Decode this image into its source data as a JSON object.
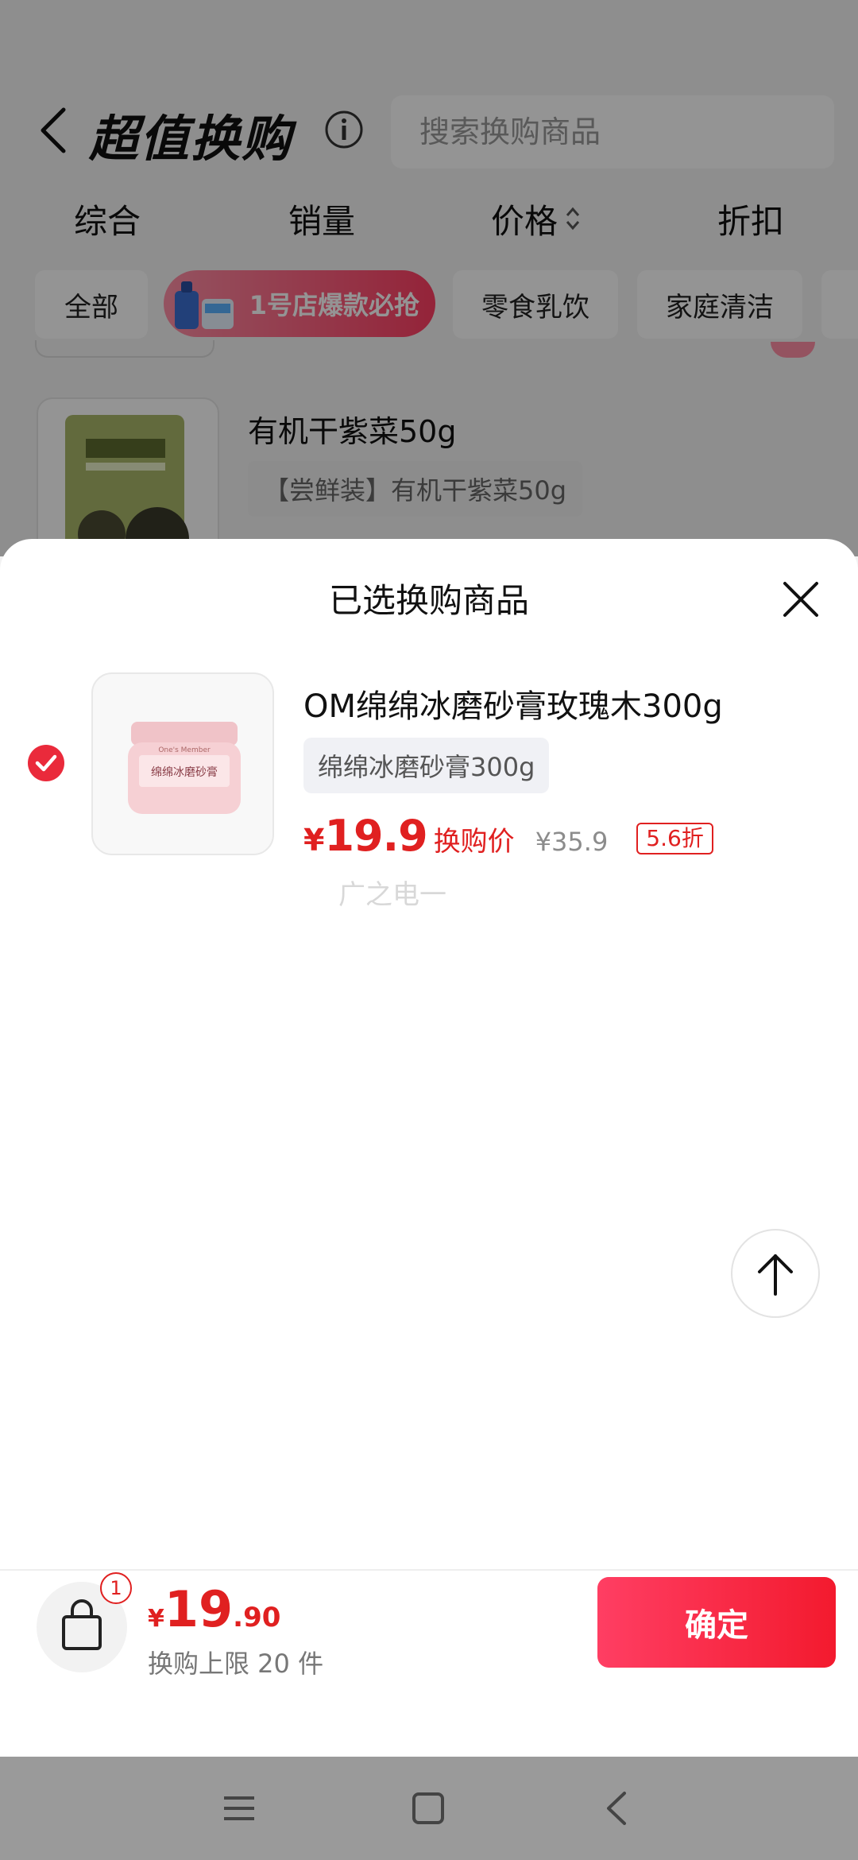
{
  "header": {
    "title": "超值换购",
    "search_placeholder": "搜索换购商品"
  },
  "sort_tabs": [
    "综合",
    "销量",
    "价格",
    "折扣"
  ],
  "categories": {
    "all": "全部",
    "promo": "1号店爆款必抢",
    "snacks": "零食乳饮",
    "cleaning": "家庭清洁"
  },
  "background_product": {
    "title": "有机干紫菜50g",
    "subtitle": "【尝鲜装】有机干紫菜50g"
  },
  "sheet": {
    "title": "已选换购商品",
    "item": {
      "title": "OM绵绵冰磨砂膏玫瑰木300g",
      "spec": "绵绵冰磨砂膏300g",
      "price_symbol": "¥",
      "price": "19.9",
      "price_tag": "换购价",
      "original_price": "¥35.9",
      "discount": "5.6折",
      "selected": true,
      "jar_label": "绵绵冰磨砂膏",
      "jar_brand": "One's Member"
    },
    "watermark": "广之电一"
  },
  "footer": {
    "cart_count": "1",
    "total_symbol": "¥",
    "total_int": "19",
    "total_dec": ".90",
    "limit_text": "换购上限 20 件",
    "confirm_label": "确定"
  },
  "colors": {
    "accent_red": "#e02020",
    "button_gradient_start": "#ff3e63",
    "button_gradient_end": "#f31a2e",
    "navbar": "#9a9a9a"
  },
  "icons": {
    "back": "chevron-left-icon",
    "info": "info-icon",
    "sort": "sort-updown-icon",
    "close": "close-icon",
    "check": "check-circle-icon",
    "top": "arrow-up-icon",
    "cart": "shopping-bag-icon",
    "nav_menu": "menu-icon",
    "nav_home": "home-square-icon",
    "nav_back": "nav-back-icon"
  }
}
